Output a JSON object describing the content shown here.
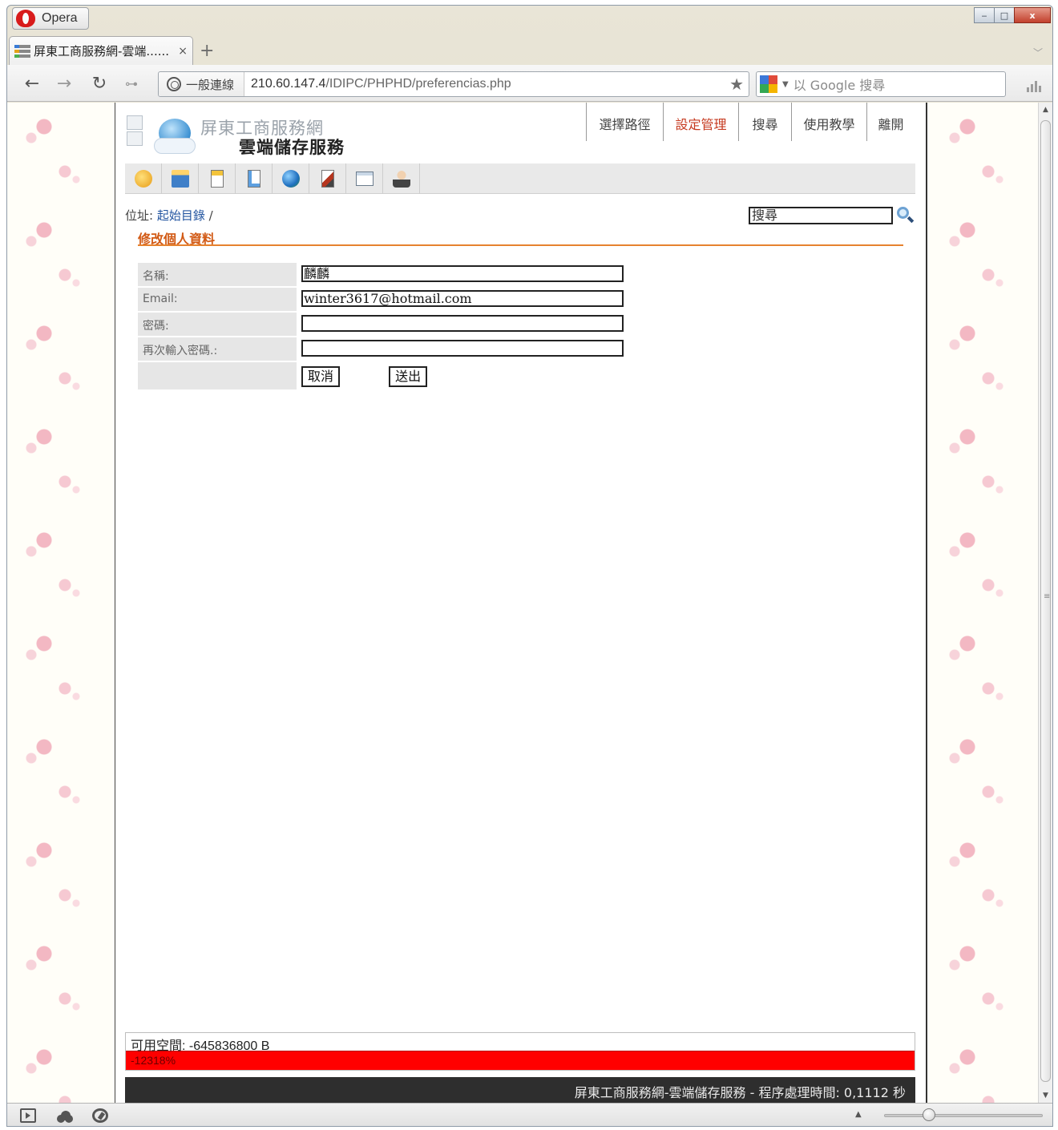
{
  "browser": {
    "app_label": "Opera",
    "tab_title": "屏東工商服務網-雲端......",
    "tab_close": "×",
    "new_tab": "+",
    "security_label": "一般連線",
    "url_host": "210.60.147.4",
    "url_path": "/IDIPC/PHPHD/preferencias.php",
    "search_placeholder": "以 Google 搜尋",
    "window_controls": {
      "minimize": "‒",
      "maximize": "□",
      "close": "x"
    }
  },
  "site": {
    "title": "屏東工商服務網",
    "subtitle": "雲端儲存服務",
    "nav": [
      {
        "label": "選擇路徑",
        "active": false
      },
      {
        "label": "設定管理",
        "active": true
      },
      {
        "label": "搜尋",
        "active": false
      },
      {
        "label": "使用教學",
        "active": false
      },
      {
        "label": "離開",
        "active": false
      }
    ],
    "toolbar_icons": [
      "go-up-icon",
      "new-folder-icon",
      "new-file-icon",
      "upload-icon",
      "globe-icon",
      "file-manager-icon",
      "window-icon",
      "user-icon"
    ]
  },
  "location": {
    "label": "位址:",
    "crumb": "起始目錄",
    "separator": "/"
  },
  "search": {
    "value": "搜尋"
  },
  "form": {
    "section_title": "修改個人資料",
    "name_label": "名稱:",
    "name_value": "麟麟",
    "email_label": "Email:",
    "email_value": "winter3617@hotmail.com",
    "password_label": "密碼:",
    "password_value": "",
    "confirm_label": "再次輸入密碼.:",
    "confirm_value": "",
    "cancel_label": "取消",
    "submit_label": "送出"
  },
  "quota": {
    "text": "可用空間: -645836800 B",
    "percent_text": "-12318%",
    "bar_color": "#ff0000"
  },
  "footer": {
    "text": "屏東工商服務網-雲端儲存服務 - 程序處理時間: 0,1112 秒"
  },
  "colors": {
    "accent_orange": "#d25a15",
    "active_nav": "#c63a20",
    "link_blue": "#2355a0",
    "footer_bg": "#2e2e2e"
  }
}
